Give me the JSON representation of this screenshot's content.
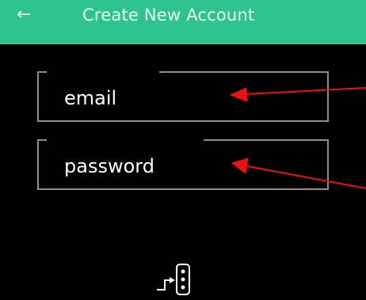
{
  "header": {
    "back_icon": "←",
    "title": "Create New Account"
  },
  "form": {
    "email_placeholder": "email",
    "password_placeholder": "password"
  },
  "icons": {
    "back": "back-arrow-icon",
    "bottom": "step-list-icon"
  },
  "colors": {
    "header_bg": "#2fc48f",
    "screen_bg": "#000000",
    "field_border": "#8e8e8e",
    "annotation": "#ee1111"
  }
}
